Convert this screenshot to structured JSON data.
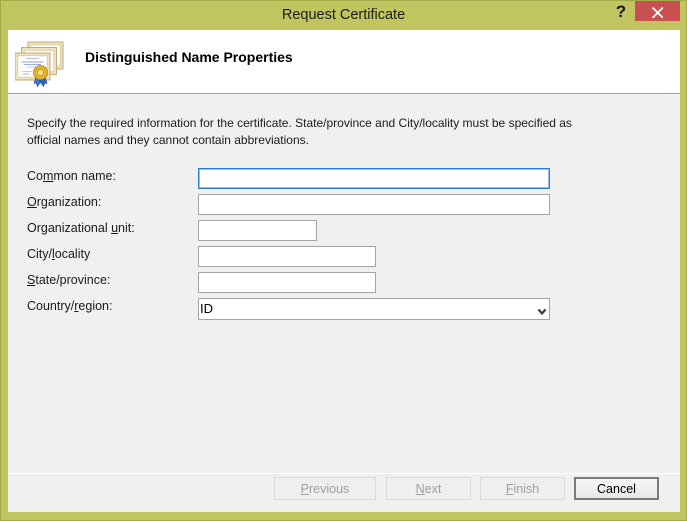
{
  "titlebar": {
    "title": "Request Certificate",
    "help_label": "?"
  },
  "header": {
    "title": "Distinguished Name Properties",
    "icon": "certificates-icon"
  },
  "body": {
    "instruction": "Specify the required information for the certificate. State/province and City/locality must be specified as official names and they cannot contain abbreviations."
  },
  "form": {
    "fields": [
      {
        "pre": "Co",
        "key": "m",
        "post": "mon name:",
        "value": "",
        "state": "focused"
      },
      {
        "pre": "",
        "key": "O",
        "post": "rganization:",
        "value": "",
        "state": "normal"
      },
      {
        "pre": "Organizational ",
        "key": "u",
        "post": "nit:",
        "value": "",
        "state": "normal"
      },
      {
        "pre": "City/",
        "key": "l",
        "post": "ocality",
        "value": "",
        "state": "normal"
      },
      {
        "pre": "",
        "key": "S",
        "post": "tate/province:",
        "value": "",
        "state": "normal"
      },
      {
        "pre": "Country/",
        "key": "r",
        "post": "egion:",
        "value": "ID",
        "selected": "ID",
        "options": [
          "ID"
        ],
        "state": "normal"
      }
    ]
  },
  "footer": {
    "buttons": [
      {
        "pre": "",
        "key": "P",
        "post": "revious",
        "enabled": false
      },
      {
        "pre": "",
        "key": "N",
        "post": "ext",
        "enabled": false
      },
      {
        "pre": "",
        "key": "F",
        "post": "inish",
        "enabled": false
      },
      {
        "pre": "Cancel",
        "key": "",
        "post": "",
        "enabled": true
      }
    ]
  },
  "colors": {
    "titlebar_olive": "#c0c55f",
    "titlebar_border": "#a4aa4a",
    "close_red": "#c94f50",
    "focus_blue": "#3079cf",
    "body_gray": "#f0f0f0"
  }
}
